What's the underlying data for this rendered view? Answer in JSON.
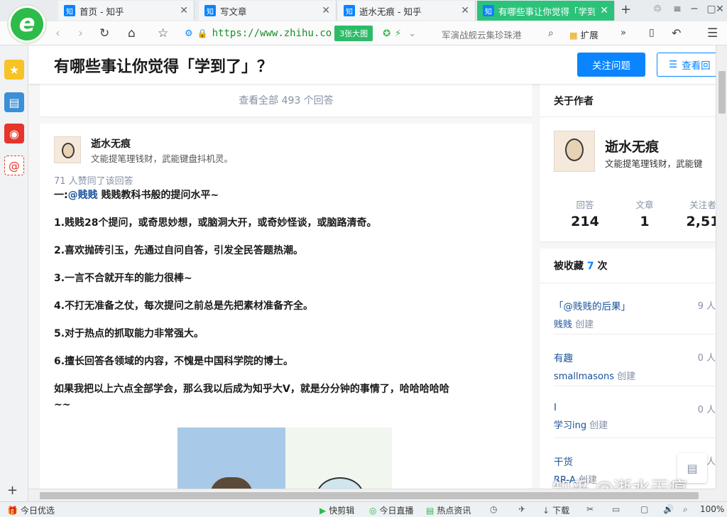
{
  "browser": {
    "tabs": [
      {
        "label": "首页 - 知乎",
        "favicon": "知"
      },
      {
        "label": "写文章",
        "favicon": "知"
      },
      {
        "label": "逝水无痕 - 知乎",
        "favicon": "知"
      },
      {
        "label": "有哪些事让你觉得「学到」",
        "favicon": "知",
        "active": true
      }
    ],
    "url": "https://www.zhihu.co",
    "image_pill": "3张大图",
    "search_hint": "军演战舰云集珍珠港",
    "extensions_label": "扩展",
    "logo_letter": "e",
    "accent_color": "#2bc37a"
  },
  "left_sidebar": {
    "icons": [
      "star-icon",
      "calendar-icon",
      "weibo-icon",
      "mail-icon"
    ]
  },
  "question": {
    "title": "有哪些事让你觉得「学到了」？",
    "follow_button": "关注问题",
    "view_button": "查看回"
  },
  "view_all": "查看全部 493 个回答",
  "answer": {
    "author_name": "逝水无痕",
    "author_bio": "文能提笔理钱财，武能键盘抖机灵。",
    "likes": "71 人赞同了该回答",
    "intro_prefix": "一:",
    "intro_mention": "@贱贱",
    "intro_suffix": " 贱贱教科书般的提问水平~",
    "points": [
      "1.贱贱28个提问，或奇思妙想，或脑洞大开，或奇妙怪谈，或脑路清奇。",
      "2.喜欢抛砖引玉，先通过自问自答，引发全民答题热潮。",
      "3.一言不合就开车的能力很棒~",
      "4.不打无准备之仗，每次提问之前总是先把素材准备齐全。",
      "5.对于热点的抓取能力非常强大。",
      "6.擅长回答各领域的内容，不愧是中国科学院的博士。"
    ],
    "conclusion_1": "如果我把以上六点全部学会，那么我以后成为知乎大V，就是分分钟的事情了，哈哈哈哈哈",
    "conclusion_2": "~~"
  },
  "about_author": {
    "title": "关于作者",
    "name": "逝水无痕",
    "bio": "文能提笔理钱财，武能键",
    "stats": [
      {
        "label": "回答",
        "value": "214"
      },
      {
        "label": "文章",
        "value": "1"
      },
      {
        "label": "关注者",
        "value": "2,51"
      }
    ]
  },
  "collections": {
    "title": "被收藏",
    "count": "7",
    "unit": "次",
    "items": [
      {
        "name": "「@贱贱的后果」",
        "count": "9 人",
        "creator": "贱贱",
        "created": "创建"
      },
      {
        "name": "有趣",
        "count": "0 人",
        "creator": "smallmasons",
        "created": "创建"
      },
      {
        "name": "I",
        "count": "0 人",
        "creator": "学习ing",
        "created": "创建"
      },
      {
        "name": "干货",
        "count": "0 人",
        "creator": "RR-A",
        "created": "创建"
      }
    ]
  },
  "watermark": "知乎 @逝水无痕",
  "statusbar": {
    "daily_pick": "今日优选",
    "items": [
      "快剪辑",
      "今日直播",
      "热点资讯",
      "下载"
    ],
    "zoom": "100%"
  }
}
